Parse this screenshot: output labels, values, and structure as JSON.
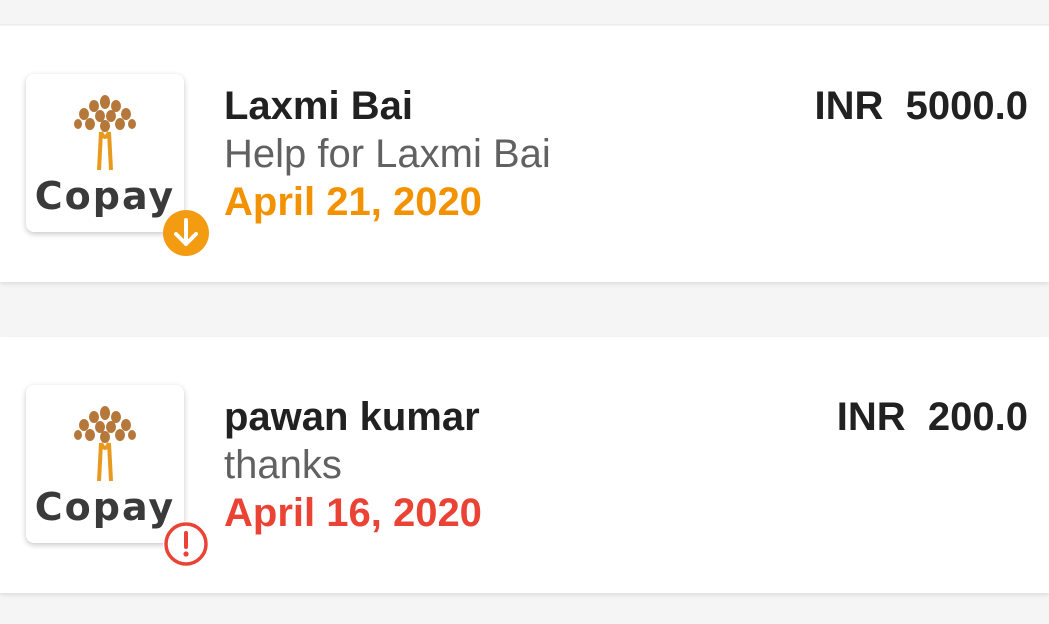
{
  "transactions": [
    {
      "name": "Laxmi Bai",
      "note": "Help for Laxmi Bai",
      "date": "April 21, 2020",
      "currency": "INR",
      "amount": "5000.0",
      "amount_display": "INR  5000.0",
      "logo_text": "Copay",
      "status_icon": "arrow-down-circle-icon",
      "status_color": "#f39200"
    },
    {
      "name": "pawan kumar",
      "note": "thanks",
      "date": "April 16, 2020",
      "currency": "INR",
      "amount": "200.0",
      "amount_display": "INR  200.0",
      "logo_text": "Copay",
      "status_icon": "alert-circle-icon",
      "status_color": "#ea4335"
    }
  ]
}
